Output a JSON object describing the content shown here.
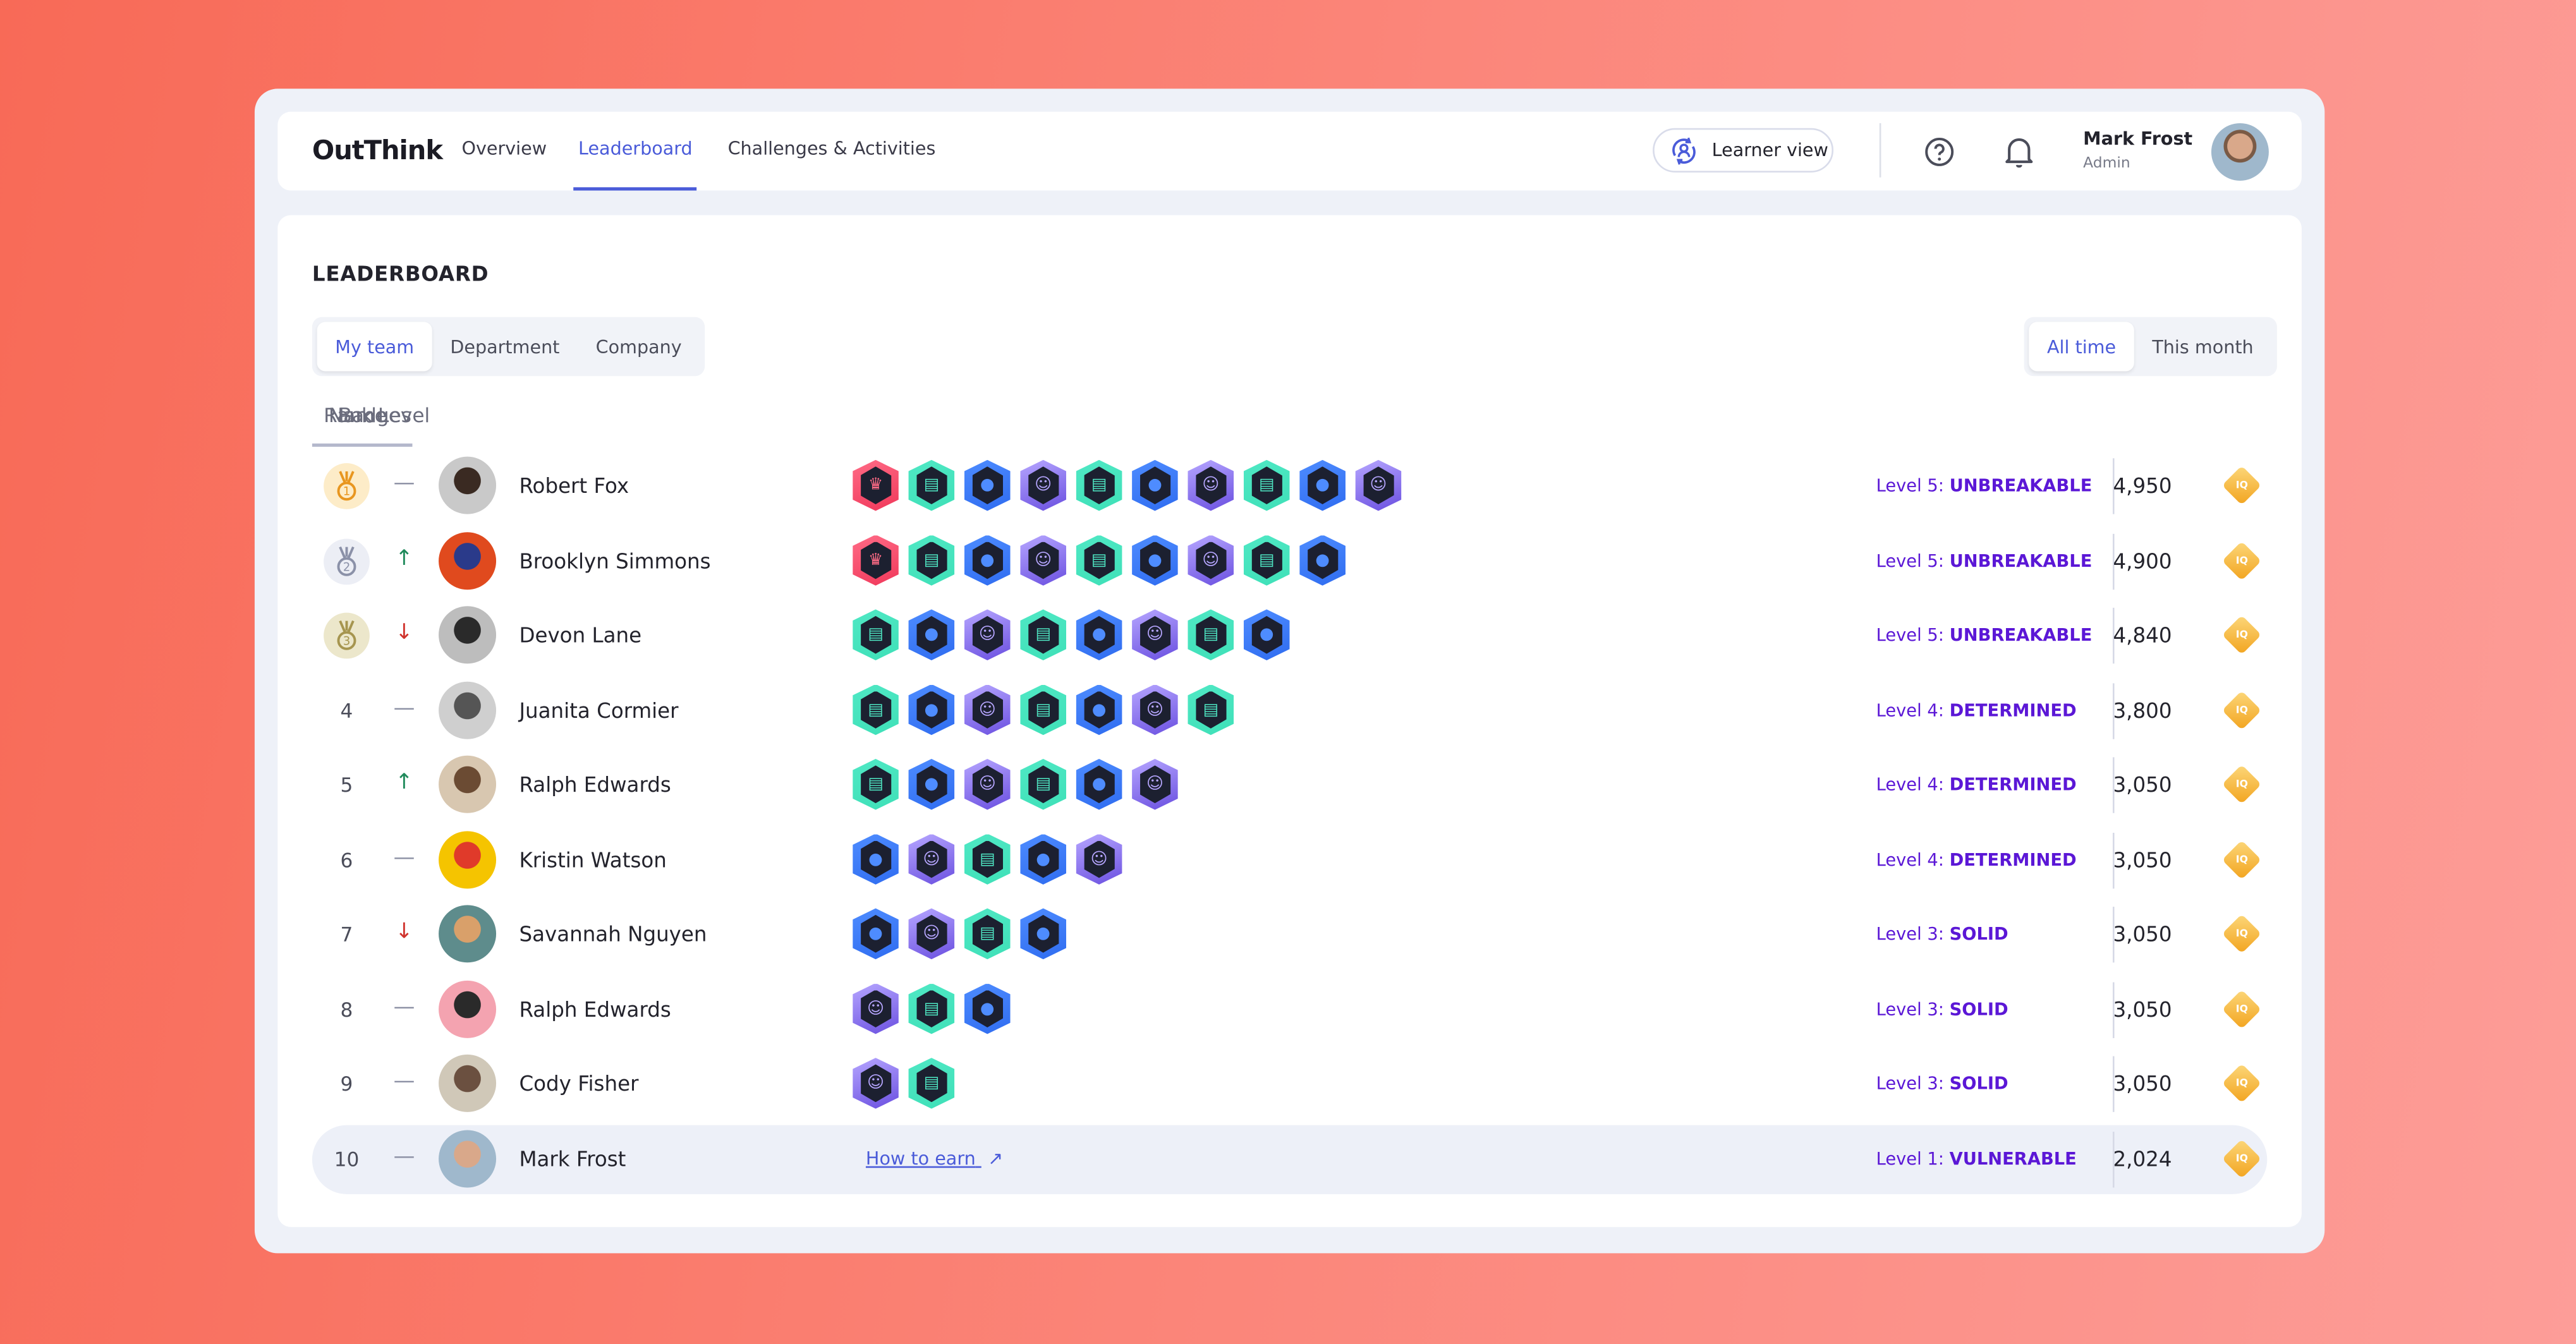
{
  "app": {
    "logo": "OutThink"
  },
  "nav": {
    "items": [
      {
        "label": "Overview"
      },
      {
        "label": "Leaderboard",
        "active": true
      },
      {
        "label": "Challenges & Activities"
      }
    ]
  },
  "header": {
    "learner_view_label": "Learner view",
    "help_icon": "question-circle-icon",
    "notifications_icon": "bell-icon",
    "user": {
      "name": "Mark Frost",
      "role": "Admin"
    }
  },
  "leaderboard": {
    "title": "LEADERBOARD",
    "scope_tabs": [
      {
        "label": "My team",
        "active": true
      },
      {
        "label": "Department"
      },
      {
        "label": "Company"
      }
    ],
    "period_tabs": [
      {
        "label": "All time",
        "active": true
      },
      {
        "label": "This month"
      }
    ],
    "columns": [
      "Rank",
      "Name",
      "Badges",
      "Level"
    ],
    "colors": {
      "accent": "#4a5bd9",
      "level": "#5b17d6",
      "up": "#1f8a5b",
      "down": "#d0332d"
    },
    "rows": [
      {
        "rank": "1",
        "medal": "gold",
        "trend": "same",
        "name": "Robert Fox",
        "badges": [
          "crown",
          "chat",
          "globe",
          "ghost",
          "chat",
          "globe",
          "ghost",
          "chat",
          "globe",
          "ghost"
        ],
        "level_prefix": "Level 5:",
        "level_name": "UNBREAKABLE",
        "points": "4,950"
      },
      {
        "rank": "2",
        "medal": "silver",
        "trend": "up",
        "name": "Brooklyn Simmons",
        "badges": [
          "crown",
          "chat",
          "globe",
          "ghost",
          "chat",
          "globe",
          "ghost",
          "chat",
          "globe"
        ],
        "level_prefix": "Level 5:",
        "level_name": "UNBREAKABLE",
        "points": "4,900"
      },
      {
        "rank": "3",
        "medal": "bronze",
        "trend": "down",
        "name": "Devon Lane",
        "badges": [
          "chat",
          "globe",
          "ghost",
          "chat",
          "globe",
          "ghost",
          "chat",
          "globe"
        ],
        "level_prefix": "Level 5:",
        "level_name": "UNBREAKABLE",
        "points": "4,840"
      },
      {
        "rank": "4",
        "trend": "same",
        "name": "Juanita Cormier",
        "badges": [
          "chat",
          "globe",
          "ghost",
          "chat",
          "globe",
          "ghost",
          "chat"
        ],
        "level_prefix": "Level 4:",
        "level_name": "DETERMINED",
        "points": "3,800"
      },
      {
        "rank": "5",
        "trend": "up",
        "name": "Ralph Edwards",
        "badges": [
          "chat",
          "globe",
          "ghost",
          "chat",
          "globe",
          "ghost"
        ],
        "level_prefix": "Level 4:",
        "level_name": "DETERMINED",
        "points": "3,050"
      },
      {
        "rank": "6",
        "trend": "same",
        "name": "Kristin Watson",
        "badges": [
          "globe",
          "ghost",
          "chat",
          "globe",
          "ghost"
        ],
        "level_prefix": "Level 4:",
        "level_name": "DETERMINED",
        "points": "3,050"
      },
      {
        "rank": "7",
        "trend": "down",
        "name": "Savannah Nguyen",
        "badges": [
          "globe",
          "ghost",
          "chat",
          "globe"
        ],
        "level_prefix": "Level 3:",
        "level_name": "SOLID",
        "points": "3,050"
      },
      {
        "rank": "8",
        "trend": "same",
        "name": "Ralph Edwards",
        "badges": [
          "ghost",
          "chat",
          "globe"
        ],
        "level_prefix": "Level 3:",
        "level_name": "SOLID",
        "points": "3,050"
      },
      {
        "rank": "9",
        "trend": "same",
        "name": "Cody Fisher",
        "badges": [
          "ghost",
          "chat"
        ],
        "level_prefix": "Level 3:",
        "level_name": "SOLID",
        "points": "3,050"
      },
      {
        "rank": "10",
        "trend": "same",
        "name": "Mark Frost",
        "current_user": true,
        "how_to_earn": "How to earn",
        "level_prefix": "Level 1:",
        "level_name": "VULNERABLE",
        "points": "2,024"
      }
    ]
  }
}
